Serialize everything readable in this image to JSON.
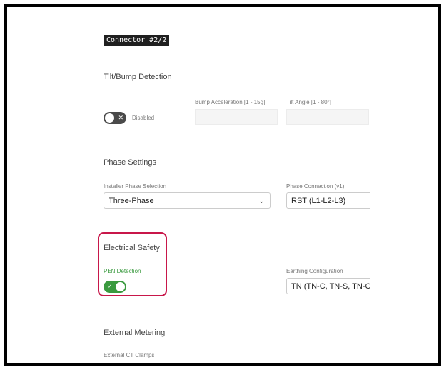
{
  "connector": {
    "label": "Connector #2/2"
  },
  "tilt_bump": {
    "title": "Tilt/Bump Detection",
    "toggle_state": "Disabled",
    "toggle_glyph": "✕",
    "bump_acceleration_label": "Bump Acceleration [1 - 15g]",
    "bump_acceleration_value": "",
    "tilt_angle_label": "Tilt Angle [1 - 80°]",
    "tilt_angle_value": ""
  },
  "phase_settings": {
    "title": "Phase Settings",
    "installer_phase_label": "Installer Phase Selection",
    "installer_phase_value": "Three-Phase",
    "chevron_glyph": "⌄",
    "phase_connection_label": "Phase Connection (v1)",
    "phase_connection_value": "RST (L1-L2-L3)"
  },
  "electrical_safety": {
    "title": "Electrical Safety",
    "pen_detection_label": "PEN Detection",
    "pen_detection_enabled": true,
    "toggle_glyph": "✓",
    "earthing_label": "Earthing Configuration",
    "earthing_value": "TN (TN-C, TN-S, TN-C-S"
  },
  "external_metering": {
    "title": "External Metering",
    "ct_clamps_label": "External CT Clamps"
  },
  "colors": {
    "highlight": "#c8174a",
    "toggle_on": "#3a9a3f",
    "toggle_off": "#4a4a4a",
    "pen_label": "#3a9a3f"
  }
}
